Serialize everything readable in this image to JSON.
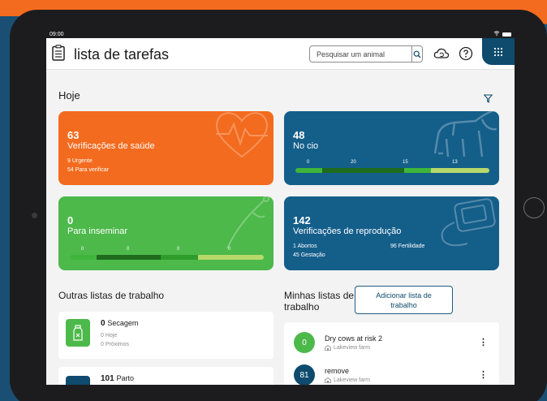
{
  "statusbar": {
    "time": "09:00"
  },
  "appbar": {
    "title": "lista de tarefas",
    "search_placeholder": "Pesquisar um animal"
  },
  "today": {
    "title": "Hoje",
    "cards": {
      "health": {
        "count": "63",
        "label": "Verificações de saúde",
        "line1": "9 Urgente",
        "line2": "54 Para verificar",
        "color": "#f36b1e"
      },
      "heat": {
        "count": "48",
        "label": "No cio",
        "ticks": [
          "0",
          "20",
          "15",
          "13"
        ],
        "color": "#145e8a"
      },
      "inseminate": {
        "count": "0",
        "label": "Para inseminar",
        "ticks": [
          "0",
          "0",
          "0",
          "0"
        ],
        "color": "#4cb94a"
      },
      "repro": {
        "count": "142",
        "label": "Verificações de reprodução",
        "abortions": "1 Abortos",
        "fertility": "96 Fertilidade",
        "gestation": "45 Gestação",
        "color": "#145e8a"
      }
    }
  },
  "other_lists": {
    "title": "Outras listas de trabalho",
    "items": [
      {
        "count": "0",
        "name": "Secagem",
        "today": "0 Hoje",
        "upcoming": "0 Próximos",
        "icon": "bottle-icon"
      },
      {
        "count": "101",
        "name": "Parto",
        "icon": "calving-icon"
      }
    ]
  },
  "my_lists": {
    "title": "Minhas listas de trabalho",
    "add_button": "Adicionar lista de trabalho",
    "items": [
      {
        "badge": "0",
        "name": "Dry cows at risk 2",
        "farm": "Lakeview farm",
        "badge_color": "#4cb94a"
      },
      {
        "badge": "81",
        "name": "remove",
        "farm": "Lakeview farm",
        "badge_color": "#0e4b6d"
      }
    ]
  }
}
